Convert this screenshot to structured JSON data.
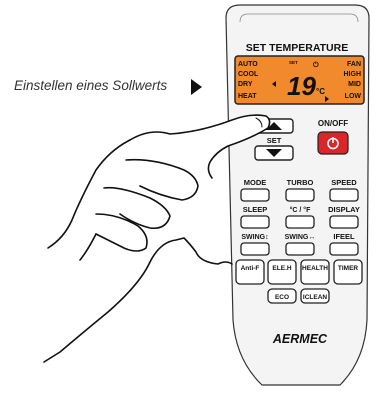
{
  "caption": "Einstellen eines Sollwerts",
  "remote": {
    "header": "SET TEMPERATURE",
    "display": {
      "modes_left": [
        "AUTO",
        "COOL",
        "DRY",
        "HEAT"
      ],
      "modes_right": [
        "FAN",
        "HIGH",
        "MID",
        "LOW"
      ],
      "set_tag": "SET",
      "temperature": "19",
      "unit": "°C",
      "background": "#f08a2c"
    },
    "set_button": "SET",
    "onoff_label": "ON/OFF",
    "power_color": "#d8262a",
    "row1": [
      "MODE",
      "TURBO",
      "SPEED"
    ],
    "row2": [
      "SLEEP",
      "°C / °F",
      "DISPLAY"
    ],
    "row3": [
      "SWING↕",
      "SWING↔",
      "IFEEL"
    ],
    "row4": [
      "Anti-F",
      "ELE.H",
      "HEALTH",
      "TIMER"
    ],
    "row5": [
      "ECO",
      "ICLEAN"
    ],
    "brand": "AERMEC"
  }
}
